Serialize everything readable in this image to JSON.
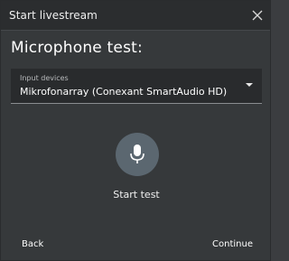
{
  "window": {
    "title": "Start livestream",
    "close_icon": "close-icon"
  },
  "main": {
    "heading": "Microphone test:",
    "input_devices": {
      "label": "Input devices",
      "selected": "Mikrofonarray (Conexant SmartAudio HD)",
      "icon": "chevron-down-icon"
    },
    "mic_button": {
      "icon": "microphone-icon",
      "caption": "Start test"
    }
  },
  "footer": {
    "back_label": "Back",
    "continue_label": "Continue"
  },
  "colors": {
    "background": "#36393b",
    "titlebar": "#2b2d2f",
    "select_bg": "#292b2d",
    "mic_button": "#5b6770",
    "text": "#ffffff"
  }
}
